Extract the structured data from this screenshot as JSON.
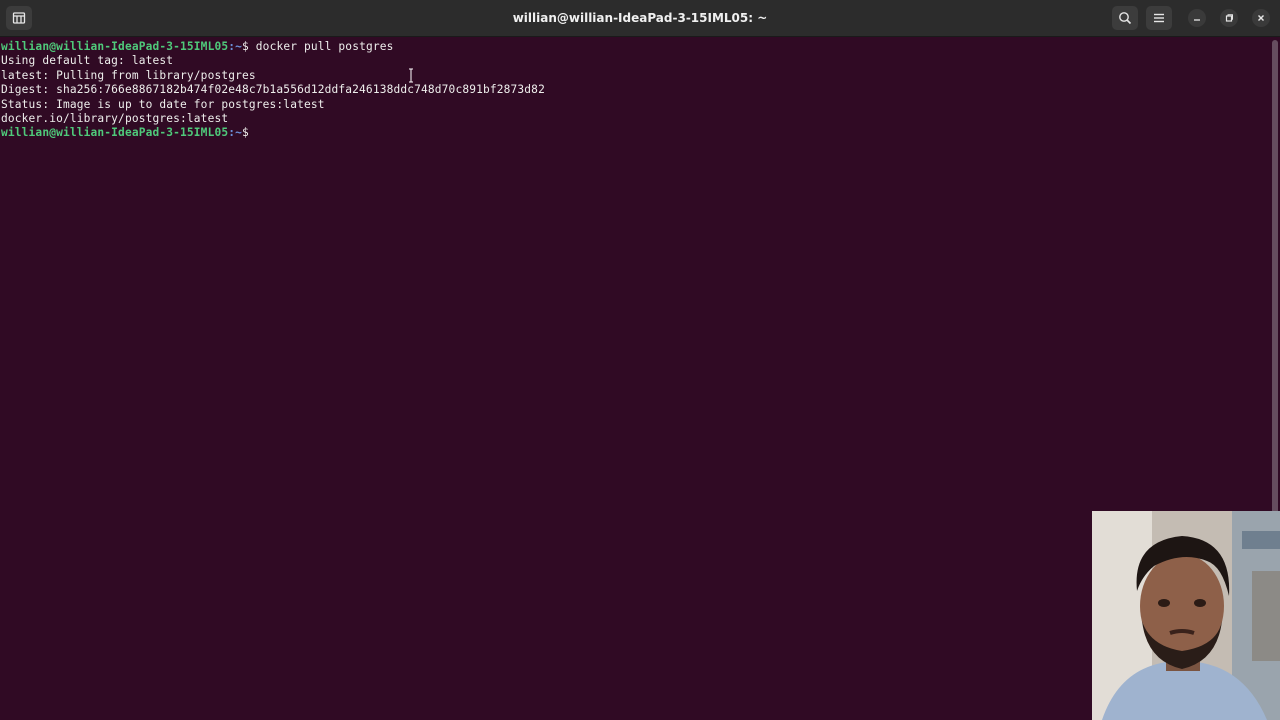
{
  "window": {
    "title": "willian@willian-IdeaPad-3-15IML05: ~"
  },
  "icons": {
    "new_tab": "new-tab-icon",
    "search": "search-icon",
    "menu": "hamburger-menu-icon",
    "minimize": "minimize-icon",
    "maximize": "maximize-icon",
    "close": "close-icon"
  },
  "colors": {
    "terminal_bg": "#300a24",
    "prompt_user": "#4fc97a",
    "prompt_path": "#6b8fd8",
    "text": "#eeeeec"
  },
  "terminal": {
    "prompt_user": "willian@willian-IdeaPad-3-15IML05",
    "prompt_path": ":~",
    "prompt_symbol": "$ ",
    "command": "docker pull postgres",
    "output": [
      "Using default tag: latest",
      "latest: Pulling from library/postgres",
      "Digest: sha256:766e8867182b474f02e48c7b1a556d12ddfa246138ddc748d70c891bf2873d82",
      "Status: Image is up to date for postgres:latest",
      "docker.io/library/postgres:latest"
    ]
  }
}
